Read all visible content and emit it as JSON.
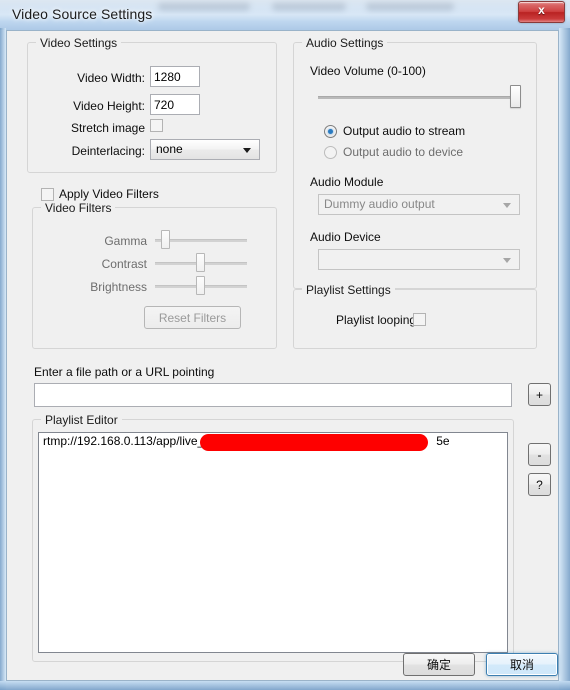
{
  "window": {
    "title": "Video Source Settings",
    "close_label": "x"
  },
  "video_settings": {
    "group_title": "Video Settings",
    "width_label": "Video Width:",
    "width_value": "1280",
    "height_label": "Video Height:",
    "height_value": "720",
    "stretch_label": "Stretch image",
    "stretch_checked": false,
    "deinterlacing_label": "Deinterlacing:",
    "deinterlacing_value": "none"
  },
  "video_filters": {
    "apply_label": "Apply Video Filters",
    "apply_checked": false,
    "group_title": "Video Filters",
    "gamma_label": "Gamma",
    "gamma_value": 8,
    "contrast_label": "Contrast",
    "contrast_value": 50,
    "brightness_label": "Brightness",
    "brightness_value": 50,
    "reset_label": "Reset Filters",
    "reset_enabled": false
  },
  "audio_settings": {
    "group_title": "Audio Settings",
    "volume_label": "Video Volume (0-100)",
    "volume_value": 100,
    "output_stream_label": "Output audio to stream",
    "output_stream_selected": true,
    "output_device_label": "Output audio to device",
    "output_device_selected": false,
    "module_label": "Audio Module",
    "module_value": "Dummy audio output",
    "module_enabled": false,
    "device_label": "Audio Device",
    "device_value": "",
    "device_enabled": false
  },
  "playlist_settings": {
    "group_title": "Playlist Settings",
    "looping_label": "Playlist looping",
    "looping_checked": false
  },
  "file_path": {
    "label": "Enter a file path or a URL pointing",
    "value": "",
    "placeholder": ""
  },
  "playlist_editor": {
    "group_title": "Playlist Editor",
    "items": [
      {
        "prefix": "rtmp://192.168.0.113/app/live_",
        "redacted": true,
        "suffix": "5e"
      }
    ]
  },
  "side_buttons": {
    "add_label": "+",
    "remove_label": "-",
    "help_label": "?"
  },
  "dialog_buttons": {
    "ok_label": "确定",
    "cancel_label": "取消",
    "focused": "cancel"
  },
  "colors": {
    "accent": "#3c7fb1",
    "redaction": "#fe0000",
    "radio_dot": "#2a7ac0",
    "dialog_bg": "#f0f0f0",
    "close_button": "#cf4040"
  }
}
